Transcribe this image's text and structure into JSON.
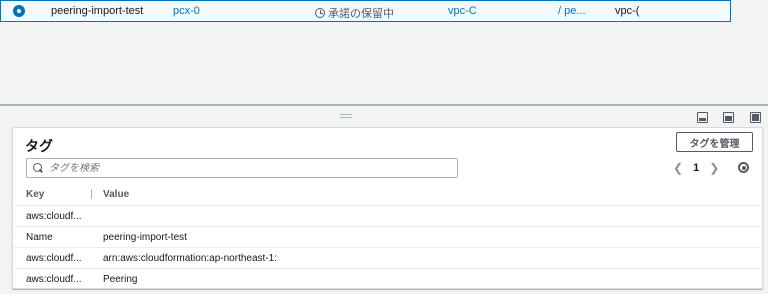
{
  "selected_row": {
    "name": "peering-import-test",
    "id": "pcx-0",
    "status": "承諾の保留中",
    "requester_vpc": "vpc-C",
    "accepter": "/ pe...",
    "accepter_vpc": "vpc-("
  },
  "details": {
    "title": "タグ",
    "manage_button": "タグを管理",
    "search_placeholder": "タグを検索",
    "page_number": "1",
    "columns": [
      "Key",
      "Value"
    ],
    "rows": [
      {
        "key": "aws:cloudf...",
        "value": ""
      },
      {
        "key": "Name",
        "value": "peering-import-test"
      },
      {
        "key": "aws:cloudf...",
        "value": "arn:aws:cloudformation:ap-northeast-1:"
      },
      {
        "key": "aws:cloudf...",
        "value": "Peering"
      }
    ]
  },
  "colors": {
    "accent": "#0073bb",
    "selected_bg": "#f1faff"
  },
  "icons": [
    "radio-selected-icon",
    "clock-icon",
    "drag-handle-icon",
    "split-bottom-icon",
    "split-side-icon",
    "split-full-icon",
    "search-icon",
    "chevron-left-icon",
    "chevron-right-icon",
    "gear-icon"
  ]
}
